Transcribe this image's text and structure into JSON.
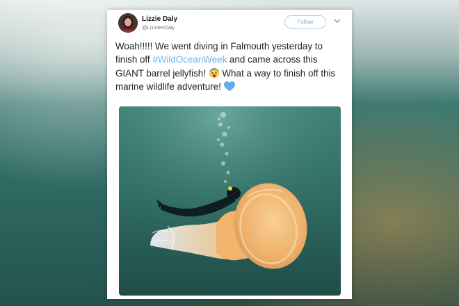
{
  "tweet": {
    "author": {
      "name": "Lizzie Daly",
      "handle": "@LizzieRDaly"
    },
    "follow_label": "Follow",
    "text_part1": "Woah!!!!! We went diving in Falmouth yesterday to finish off ",
    "hashtag": "#WildOceanWeek",
    "text_part2": " and came across this GIANT barrel jellyfish! ",
    "text_part3": " What a way to finish off this marine wildlife adventure! ",
    "emoji_1": "fearful-face-emoji",
    "emoji_2": "blue-heart-emoji",
    "photo": "diver-and-barrel-jellyfish-photo"
  },
  "colors": {
    "hashtag": "#63b9e8",
    "follow_border": "#9ed1f7",
    "water": "#2f6b64",
    "jellyfish": "#f3b36c"
  }
}
